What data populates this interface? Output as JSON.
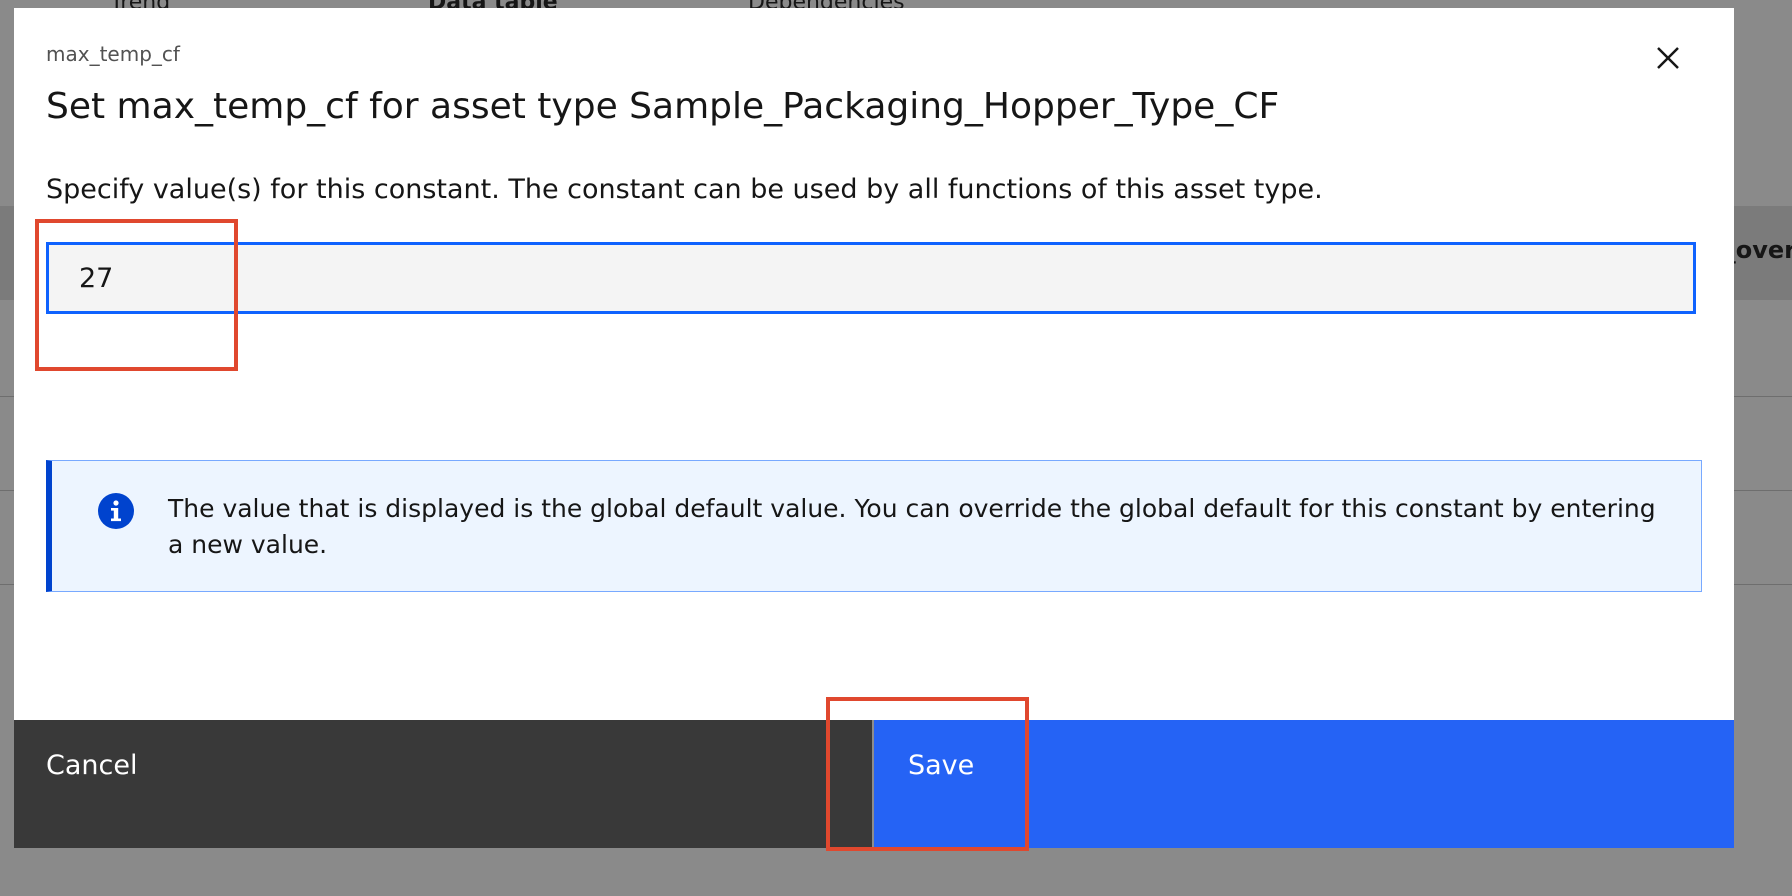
{
  "background": {
    "tabs": [
      "Trend",
      "Data table",
      "Dependencies"
    ],
    "header_fragment": "_over"
  },
  "modal": {
    "label": "max_temp_cf",
    "title": "Set max_temp_cf for asset type Sample_Packaging_Hopper_Type_CF",
    "description": "Specify value(s) for this constant. The constant can be used by all functions of this asset type.",
    "input_value": "27",
    "notification": "The value that is displayed is the global default value. You can override the global default for this constant by entering a new value.",
    "close_icon": "close-icon",
    "info_icon": "info-icon"
  },
  "footer": {
    "cancel_label": "Cancel",
    "save_label": "Save"
  },
  "colors": {
    "primary": "#2563f5",
    "secondary_button": "#393939",
    "info_border": "#0043ce",
    "info_bg": "#edf5ff",
    "highlight": "#e0482e"
  }
}
